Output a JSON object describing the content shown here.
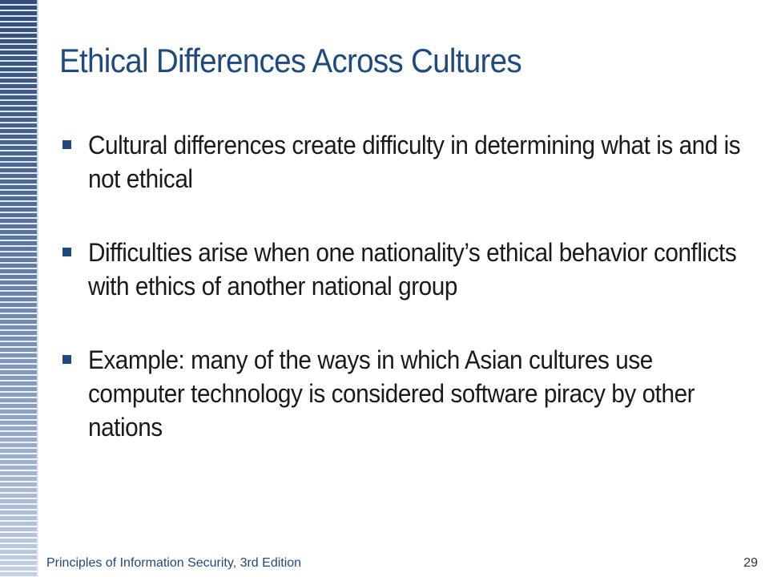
{
  "slide": {
    "title": "Ethical Differences Across Cultures",
    "bullets": [
      {
        "text": "Cultural differences create difficulty in determining what is and is not ethical"
      },
      {
        "text": "Difficulties arise when one nationality’s ethical behavior conflicts with ethics of another national group"
      },
      {
        "text": "Example: many of the ways in which Asian cultures use computer technology is considered software piracy by other nations"
      }
    ],
    "footer": {
      "source": "Principles of Information Security, 3rd Edition",
      "page_number": "29"
    }
  },
  "colors": {
    "title": "#1f4a7f",
    "body_text": "#1a1a1a",
    "bullet_marker": "#1f4a7f",
    "sidebar_dark": "#2f4f7a",
    "sidebar_light": "#c4d0e2"
  }
}
